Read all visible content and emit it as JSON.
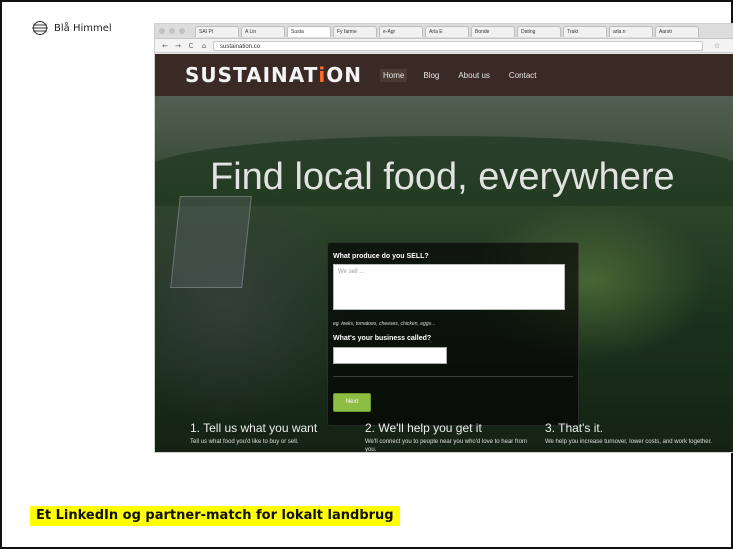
{
  "brand": {
    "name": "Blå Himmel",
    "icon": "blue-sky-logo-icon"
  },
  "browser": {
    "tabs": [
      "SAI Pl",
      "A Lin",
      "Susta",
      "Fy farme",
      "e-Agr",
      "Arla E",
      "Bonde",
      "Dating",
      "Trakt",
      "arla.n",
      "Aarsti"
    ],
    "url": "sustaination.co",
    "controls": {
      "back": "←",
      "forward": "→",
      "refresh": "C",
      "home": "⌂",
      "star": "☆"
    }
  },
  "site": {
    "logo_left": "SUSTAINAT",
    "logo_hl": "i",
    "logo_tail": "ON",
    "nav": [
      "Home",
      "Blog",
      "About us",
      "Contact"
    ],
    "hero_title": "Find local food, everywhere",
    "form": {
      "question_sell": "What produce do you SELL?",
      "sell_placeholder": "We sell ...",
      "hint": "eg. leeks, tomatoes, cheeses, chicken, eggs...",
      "question_business": "What's your business called?",
      "next": "Next"
    },
    "steps": [
      {
        "title": "1. Tell us what you want",
        "text": "Tell us what food you'd like to buy or sell."
      },
      {
        "title": "2. We'll help you get it",
        "text": "We'll connect you to people near you who'd love to hear from you."
      },
      {
        "title": "3. That's it.",
        "text": "We help you increase turnover, lower costs, and work together."
      }
    ]
  },
  "caption": "Et LinkedIn og partner-match for lokalt landbrug"
}
